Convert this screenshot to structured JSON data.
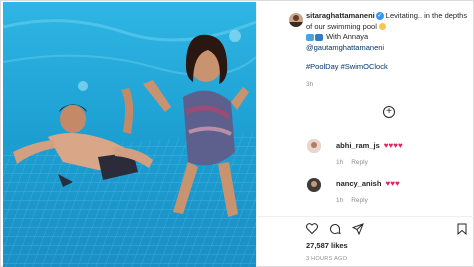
{
  "post": {
    "username": "sitaraghattamaneni",
    "caption_text": "Levitating.. in the depths of our swimming pool",
    "caption_with": "With Annaya",
    "mention": "@gautamghattamaneni",
    "hashtags": "#PoolDay #SwimOClock",
    "posted_ago": "3h",
    "likes_count": "27,587",
    "likes_label": "likes",
    "time_ago_full": "3 HOURS AGO"
  },
  "comments": [
    {
      "username": "abhi_ram_js",
      "hearts": "♥♥♥♥",
      "time": "1h",
      "reply_label": "Reply"
    },
    {
      "username": "nancy_anish",
      "hearts": "♥♥♥",
      "time": "1h",
      "reply_label": "Reply"
    }
  ],
  "icons": {
    "verified": "verified-badge-icon",
    "load_more": "plus-circle-icon",
    "like": "heart-outline-icon",
    "comment": "comment-icon",
    "share": "paper-plane-icon",
    "save": "bookmark-icon"
  },
  "colors": {
    "link": "#00376b",
    "verified": "#3897f0",
    "heart": "#e0245e",
    "muted": "#8e8e8e",
    "water": "#1f9fd1"
  }
}
